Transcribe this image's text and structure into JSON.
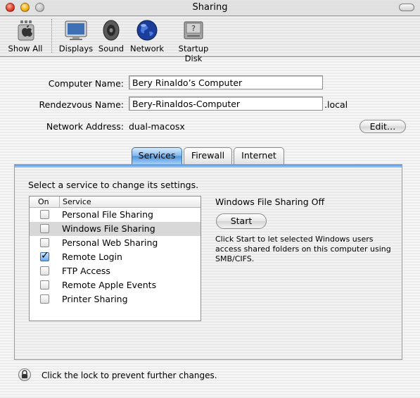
{
  "window": {
    "title": "Sharing"
  },
  "toolbar": {
    "items": [
      {
        "label": "Show All",
        "icon": "apple-prefs-icon"
      },
      {
        "label": "Displays",
        "icon": "display-icon"
      },
      {
        "label": "Sound",
        "icon": "speaker-icon"
      },
      {
        "label": "Network",
        "icon": "globe-icon"
      },
      {
        "label": "Startup Disk",
        "icon": "disk-icon"
      }
    ]
  },
  "form": {
    "computer_name_label": "Computer Name:",
    "computer_name_value": "Bery Rinaldo’s Computer",
    "rendezvous_label": "Rendezvous Name:",
    "rendezvous_value": "Bery-Rinaldos-Computer",
    "rendezvous_suffix": ".local",
    "network_address_label": "Network Address:",
    "network_address_value": "dual-macosx",
    "edit_button": "Edit…"
  },
  "tabs": [
    {
      "label": "Services",
      "active": true
    },
    {
      "label": "Firewall",
      "active": false
    },
    {
      "label": "Internet",
      "active": false
    }
  ],
  "services": {
    "instruction": "Select a service to change its settings.",
    "columns": {
      "on": "On",
      "service": "Service"
    },
    "items": [
      {
        "name": "Personal File Sharing",
        "on": false,
        "selected": false
      },
      {
        "name": "Windows File Sharing",
        "on": false,
        "selected": true
      },
      {
        "name": "Personal Web Sharing",
        "on": false,
        "selected": false
      },
      {
        "name": "Remote Login",
        "on": true,
        "selected": false
      },
      {
        "name": "FTP Access",
        "on": false,
        "selected": false
      },
      {
        "name": "Remote Apple Events",
        "on": false,
        "selected": false
      },
      {
        "name": "Printer Sharing",
        "on": false,
        "selected": false
      }
    ],
    "status": "Windows File Sharing Off",
    "start_button": "Start",
    "description": "Click Start to let selected Windows users access shared folders on this computer using SMB/CIFS."
  },
  "footer": {
    "lock_text": "Click the lock to prevent further changes."
  },
  "colors": {
    "tab_active": "#4f93d9",
    "checkbox_checked": "#6ea9e8"
  }
}
